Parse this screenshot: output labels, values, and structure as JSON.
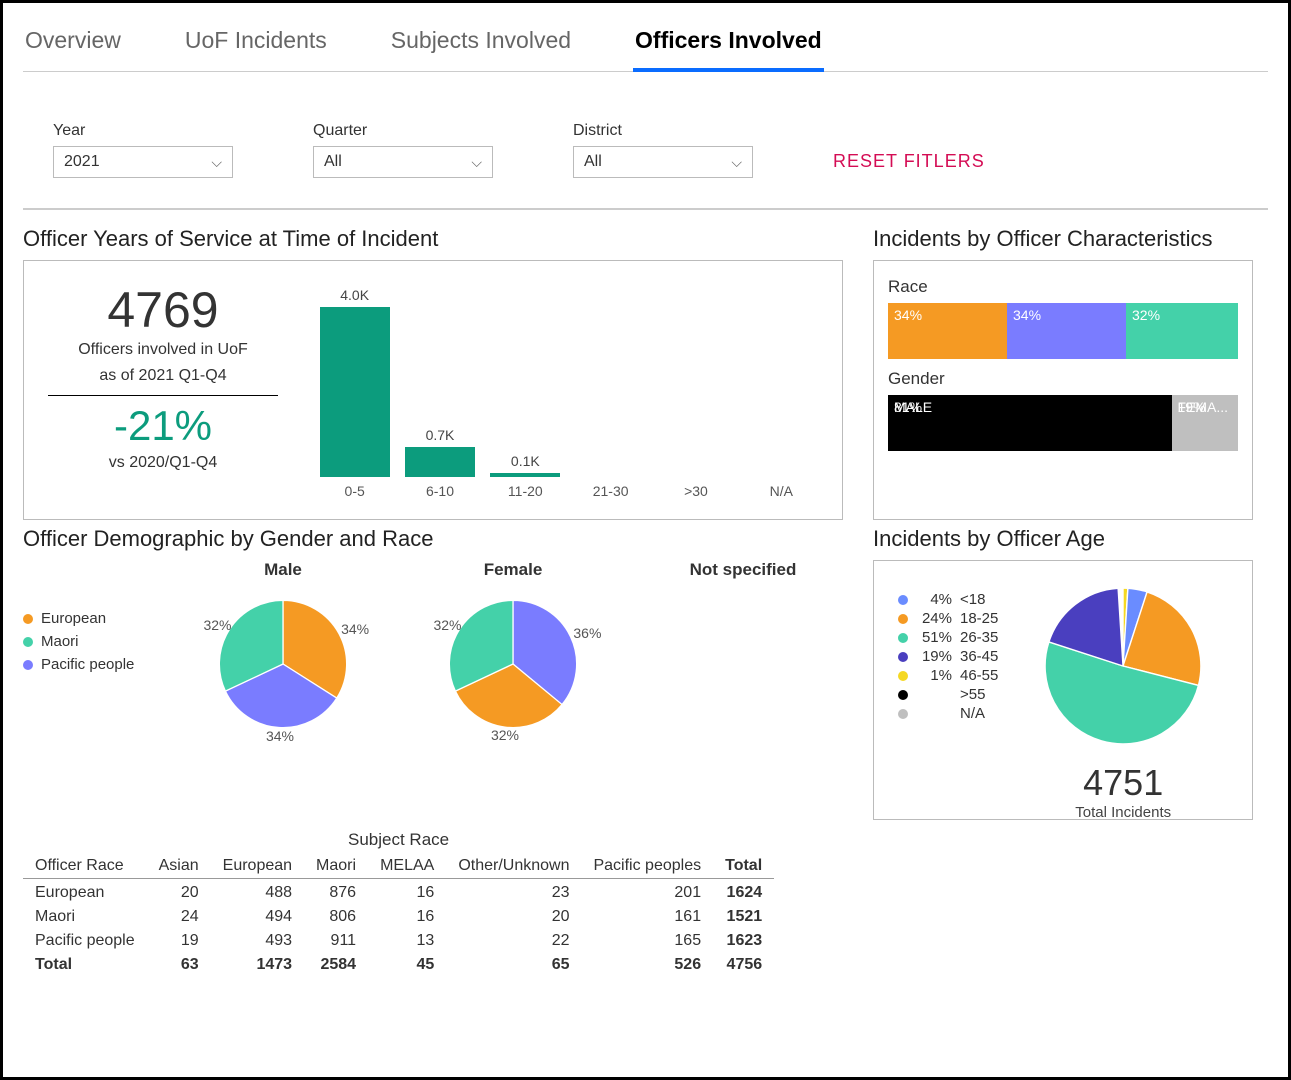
{
  "tabs": [
    "Overview",
    "UoF Incidents",
    "Subjects Involved",
    "Officers Involved"
  ],
  "activeTab": "Officers Involved",
  "filters": {
    "year": {
      "label": "Year",
      "value": "2021"
    },
    "quarter": {
      "label": "Quarter",
      "value": "All"
    },
    "district": {
      "label": "District",
      "value": "All"
    },
    "reset": "RESET FITLERS"
  },
  "kpi": {
    "count": "4769",
    "sub1": "Officers involved in UoF",
    "sub2": "as of 2021 Q1-Q4",
    "delta": "-21%",
    "vs": "vs 2020/Q1-Q4"
  },
  "sections": {
    "yos": "Officer Years of Service at Time of Incident",
    "char": "Incidents by Officer Characteristics",
    "char_race": "Race",
    "char_gender": "Gender",
    "demo": "Officer Demographic by Gender and Race",
    "age": "Incidents by Officer Age",
    "table_caption": "Subject Race"
  },
  "chart_data": {
    "yos_bar": {
      "type": "bar",
      "categories": [
        "0-5",
        "6-10",
        "11-20",
        "21-30",
        ">30",
        "N/A"
      ],
      "values": [
        4000,
        700,
        100,
        0,
        0,
        0
      ],
      "value_labels": [
        "4.0K",
        "0.7K",
        "0.1K",
        "",
        "",
        ""
      ]
    },
    "race_stacked": {
      "type": "bar",
      "series": [
        {
          "name": "",
          "pct": 34,
          "color": "#f59a23"
        },
        {
          "name": "",
          "pct": 34,
          "color": "#7a7cff"
        },
        {
          "name": "",
          "pct": 32,
          "color": "#44d1a9"
        }
      ]
    },
    "gender_stacked": {
      "type": "bar",
      "series": [
        {
          "name": "MALE",
          "pct": 81,
          "color": "#000000"
        },
        {
          "name": "FEMA...",
          "pct": 19,
          "color": "#bfbfbf"
        }
      ]
    },
    "demo_legend": [
      {
        "name": "European",
        "color": "#f59a23"
      },
      {
        "name": "Maori",
        "color": "#44d1a9"
      },
      {
        "name": "Pacific people",
        "color": "#7a7cff"
      }
    ],
    "demo_pies": [
      {
        "title": "Male",
        "slices": [
          {
            "name": "European",
            "pct": 34,
            "color": "#f59a23"
          },
          {
            "name": "Pacific people",
            "pct": 34,
            "color": "#7a7cff"
          },
          {
            "name": "Maori",
            "pct": 32,
            "color": "#44d1a9"
          }
        ]
      },
      {
        "title": "Female",
        "slices": [
          {
            "name": "Pacific people",
            "pct": 36,
            "color": "#7a7cff"
          },
          {
            "name": "European",
            "pct": 32,
            "color": "#f59a23"
          },
          {
            "name": "Maori",
            "pct": 32,
            "color": "#44d1a9"
          }
        ]
      },
      {
        "title": "Not specified",
        "slices": []
      }
    ],
    "age_pie": {
      "type": "pie",
      "total": "4751",
      "total_label": "Total Incidents",
      "slices": [
        {
          "name": "<18",
          "pct": 4,
          "color": "#6a8cff"
        },
        {
          "name": "18-25",
          "pct": 24,
          "color": "#f59a23"
        },
        {
          "name": "26-35",
          "pct": 51,
          "color": "#44d1a9"
        },
        {
          "name": "36-45",
          "pct": 19,
          "color": "#4a3fbf"
        },
        {
          "name": "46-55",
          "pct": 1,
          "color": "#f5d823"
        },
        {
          "name": ">55",
          "pct": 0,
          "color": "#000000"
        },
        {
          "name": "N/A",
          "pct": 0,
          "color": "#bfbfbf"
        }
      ]
    }
  },
  "crosstab": {
    "row_header": "Officer Race",
    "cols": [
      "Asian",
      "European",
      "Maori",
      "MELAA",
      "Other/Unknown",
      "Pacific peoples",
      "Total"
    ],
    "rows": [
      {
        "name": "European",
        "vals": [
          20,
          488,
          876,
          16,
          23,
          201,
          1624
        ]
      },
      {
        "name": "Maori",
        "vals": [
          24,
          494,
          806,
          16,
          20,
          161,
          1521
        ]
      },
      {
        "name": "Pacific people",
        "vals": [
          19,
          493,
          911,
          13,
          22,
          165,
          1623
        ]
      }
    ],
    "total": {
      "name": "Total",
      "vals": [
        63,
        1473,
        2584,
        45,
        65,
        526,
        4756
      ]
    }
  }
}
